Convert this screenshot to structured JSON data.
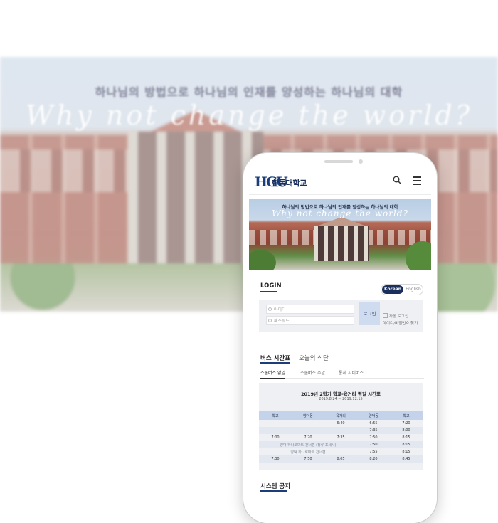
{
  "hero": {
    "slogan_ko": "하나님의 방법으로 하나님의 인재를 양성하는 하나님의 대학",
    "slogan_en": "Why not change the world?"
  },
  "header": {
    "logo_mark": "HGU",
    "logo_text": "한동대학교",
    "search_icon": "search-icon",
    "menu_icon": "hamburger-menu-icon"
  },
  "banner": {
    "slogan_ko": "하나님의 방법으로 하나님의 인재를 양성하는 하나님의 대학",
    "slogan_en": "Why not change the world?"
  },
  "login": {
    "title": "LOGIN",
    "lang_korean": "Korean",
    "lang_english": "English",
    "id_placeholder": "아이디",
    "pw_placeholder": "패스워드",
    "button": "로그인",
    "auto_login": "자동 로그인",
    "find_account": "아이디/비밀번호 찾기"
  },
  "tabs": {
    "bus": "버스 시간표",
    "meal": "오늘의 식단",
    "sub": [
      "스쿨버스 없일",
      "스쿨버스 주말",
      "통체 시티버스"
    ]
  },
  "timetable": {
    "title": "2019년 2학기 학교-육거리 평일 시간표",
    "period": "2019.8.24 ~ 2019.12.15",
    "columns": [
      "학교",
      "양덕동",
      "육거리",
      "양덕동",
      "학교"
    ],
    "rows": [
      [
        "-",
        "-",
        "6:40",
        "6:55",
        "7:20"
      ],
      [
        "-",
        "-",
        "-",
        "7:35",
        "8:00"
      ],
      [
        "7:00",
        "7:20",
        "7:35",
        "7:50",
        "8:15"
      ],
      {
        "note": "양덕 하나로마트 건너편 (정류 표세시)",
        "values": [
          "7:50",
          "8:15"
        ]
      },
      {
        "note": "양덕 하나로마트 건너편",
        "values": [
          "7:55",
          "8:15"
        ]
      },
      [
        "7:30",
        "7:50",
        "8:05",
        "8:20",
        "8:45"
      ]
    ]
  },
  "notice": {
    "title": "시스템 공지"
  },
  "colors": {
    "brand_navy": "#1b2f5c",
    "accent_blue": "#1b3d7a",
    "table_header": "#c5d3ea",
    "panel_bg": "#eef0f3"
  }
}
